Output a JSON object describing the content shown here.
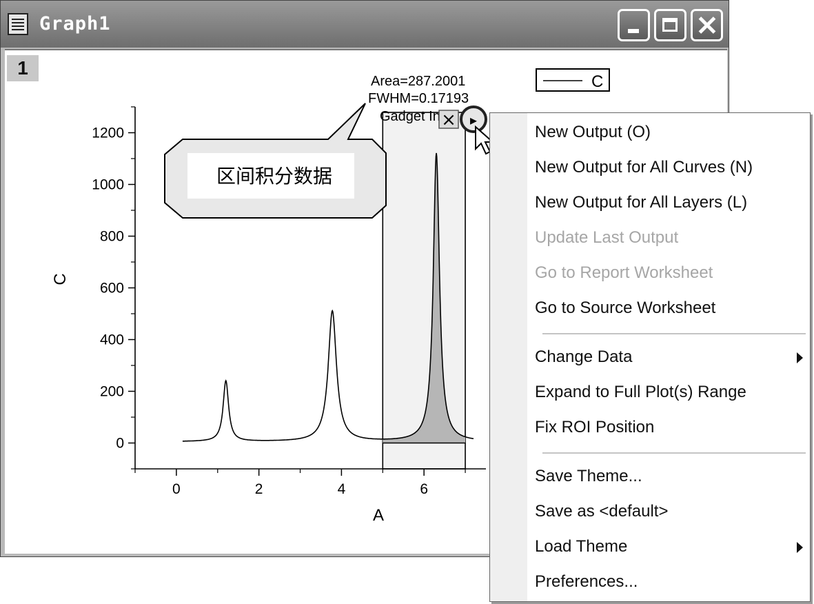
{
  "window": {
    "title": "Graph1",
    "layer_number": "1",
    "icon": "graph-window-icon"
  },
  "title_buttons": [
    "minimize-icon",
    "maximize-icon",
    "close-icon"
  ],
  "callout": {
    "text": "区间积分数据"
  },
  "gadget": {
    "area_label": "Area=287.2001",
    "fwhm_label": "FWHM=0.17193",
    "label_partial": "Gadget In",
    "close_glyph": "×",
    "menu_glyph": "▸",
    "roi_x_range": [
      5,
      7
    ]
  },
  "legend": {
    "entry": "C"
  },
  "colors": {
    "fill": "#b6b6b6",
    "roi": "#f2f2f2",
    "menu_disabled": "#a6a6a6"
  },
  "chart_data": {
    "type": "line",
    "xlabel": "A",
    "ylabel": "C",
    "xlim": [
      -1,
      7.5
    ],
    "ylim": [
      -100,
      1300
    ],
    "x_ticks": [
      "0",
      "2",
      "4",
      "6"
    ],
    "y_ticks": [
      "0",
      "200",
      "400",
      "600",
      "800",
      "1000",
      "1200"
    ],
    "series": [
      {
        "name": "C",
        "peaks": [
          {
            "x": 1.2,
            "y": 240
          },
          {
            "x": 3.78,
            "y": 510
          },
          {
            "x": 6.3,
            "y": 1120
          }
        ],
        "baseline": 5,
        "x_start": 0.15
      }
    ]
  },
  "menu": {
    "items": [
      {
        "label": "New Output (O)",
        "enabled": true
      },
      {
        "label": "New Output for All Curves (N)",
        "enabled": true
      },
      {
        "label": "New Output for All Layers (L)",
        "enabled": true
      },
      {
        "label": "Update Last Output",
        "enabled": false
      },
      {
        "label": "Go to Report Worksheet",
        "enabled": false
      },
      {
        "label": "Go to Source Worksheet",
        "enabled": true
      },
      {
        "label": "Change Data",
        "enabled": true,
        "submenu": true
      },
      {
        "label": "Expand to Full Plot(s) Range",
        "enabled": true
      },
      {
        "label": "Fix ROI Position",
        "enabled": true
      },
      {
        "label": "Save Theme...",
        "enabled": true
      },
      {
        "label": "Save as <default>",
        "enabled": true
      },
      {
        "label": "Load Theme",
        "enabled": true,
        "submenu": true
      },
      {
        "label": "Preferences...",
        "enabled": true
      }
    ]
  }
}
